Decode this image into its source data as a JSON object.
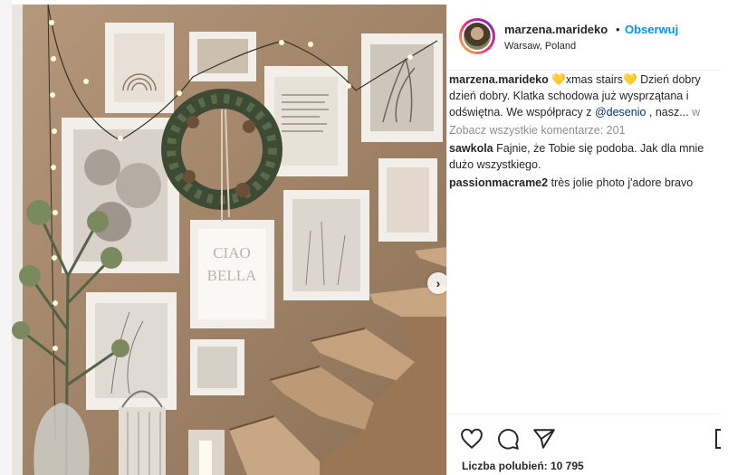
{
  "post": {
    "username": "marzena.marideko",
    "separator": "•",
    "follow_label": "Obserwuj",
    "location": "Warsaw, Poland",
    "caption": {
      "username": "marzena.marideko",
      "heart1": "💛",
      "title": "xmas stairs",
      "heart2": "💛",
      "line1_rest": " Dzień dobry",
      "line2": "dzień dobry. Klatka schodowa już wysprzątana i",
      "line3_start": "odświętna. We współpracy z ",
      "mention": "@desenio",
      "line3_end": " , nasz...",
      "more": " w"
    },
    "view_all_comments": "Zobacz wszystkie komentarze: 201",
    "comments": [
      {
        "username": "sawkola",
        "text": " Fajnie, że Tobie się podoba. Jak dla mnie",
        "text2": "dużo wszystkiego."
      },
      {
        "username": "passionmacrame2",
        "text": " très jolie photo j'adore bravo"
      }
    ],
    "likes_label": "Liczba polubień: 10 795",
    "icons": [
      "heart-icon",
      "comment-icon",
      "share-icon",
      "bookmark-icon",
      "chevron-right-icon"
    ],
    "frame_text": {
      "ciao": "CIAO",
      "bella": "BELLA"
    }
  }
}
